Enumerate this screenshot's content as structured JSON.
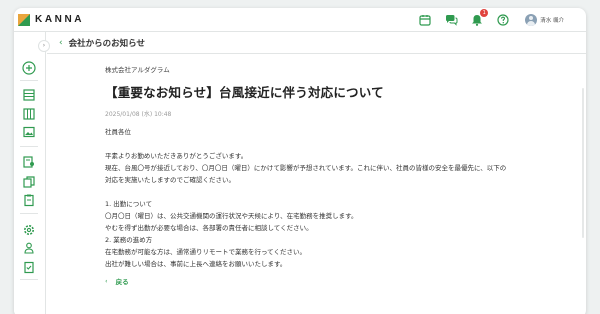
{
  "app": {
    "logo_text": "KANNA",
    "brand_green": "#2f9a4f",
    "brand_orange": "#e9a53d"
  },
  "topbar": {
    "icons": [
      "calendar-icon",
      "chat-icon",
      "bell-icon",
      "help-icon"
    ],
    "notification_count": "1",
    "user_name": "清水 颯介"
  },
  "sidebar": {
    "icons": [
      "plus-circle-icon",
      "table-icon",
      "columns-icon",
      "image-icon",
      "user-card-icon",
      "copy-docs-icon",
      "clipboard-icon",
      "gear-icon",
      "person-icon",
      "checklist-icon"
    ]
  },
  "header": {
    "title": "会社からのお知らせ"
  },
  "announcement": {
    "company": "株式会社アルダグラム",
    "title": "【重要なお知らせ】台風接近に伴う対応について",
    "datetime": "2025/01/08 (水) 10:48",
    "body": [
      "社員各位",
      "",
      "平素よりお勤めいただきありがとうございます。",
      "現在、台風〇号が接近しており、〇月〇日（曜日）にかけて影響が予想されています。これに伴い、社員の皆様の安全を最優先に、以下の",
      "対応を実施いたしますのでご確認ください。",
      "",
      "1. 出勤について",
      "〇月〇日（曜日）は、公共交通機関の運行状況や天候により、在宅勤務を推奨します。",
      "やむを得ず出勤が必要な場合は、各部署の責任者に相談してください。",
      "2. 業務の進め方",
      "在宅勤務が可能な方は、通常通りリモートで業務を行ってください。",
      "出社が難しい場合は、事前に上長へ連絡をお願いいたします。"
    ],
    "back_label": "戻る"
  }
}
